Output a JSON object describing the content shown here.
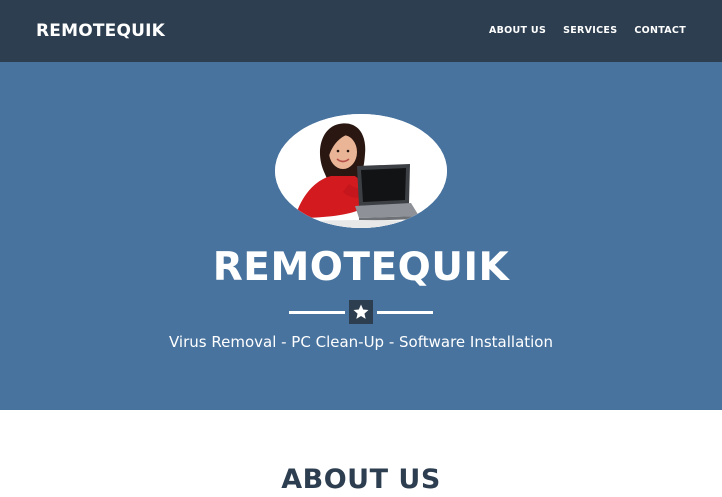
{
  "navbar": {
    "brand": "REMOTEQUIK",
    "links": [
      "ABOUT US",
      "SERVICES",
      "CONTACT"
    ],
    "background": "#2d3e50"
  },
  "hero": {
    "background": "#48739f",
    "image": "woman-pointing-at-laptop",
    "title": "REMOTEQUIK",
    "divider_icon": "star-icon",
    "tagline": "Virus Removal - PC Clean-Up - Software Installation"
  },
  "about": {
    "heading": "ABOUT US"
  }
}
